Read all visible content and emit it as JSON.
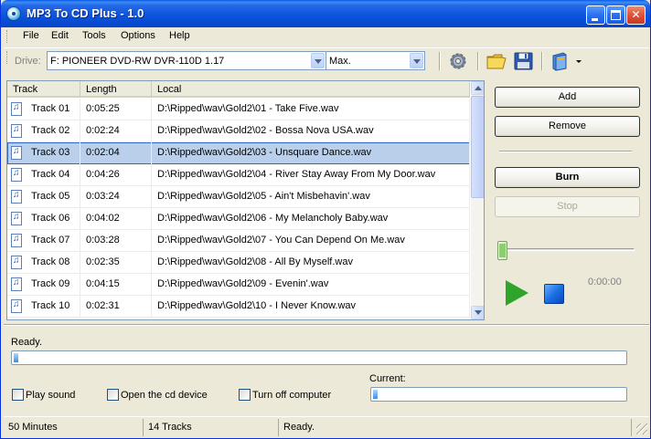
{
  "window": {
    "title": "MP3 To CD Plus - 1.0"
  },
  "menu": [
    "File",
    "Edit",
    "Tools",
    "Options",
    "Help"
  ],
  "toolbar": {
    "drive_label": "Drive:",
    "drive_value": "F: PIONEER  DVD-RW  DVR-110D 1.17",
    "speed_value": "Max.",
    "icons": [
      "gear-icon",
      "folder-open-icon",
      "save-disk-icon",
      "cd-case-icon"
    ]
  },
  "list": {
    "columns": [
      "Track",
      "Length",
      "Local"
    ],
    "rows": [
      {
        "track": "Track 01",
        "length": "0:05:25",
        "local": "D:\\Ripped\\wav\\Gold2\\01 - Take Five.wav"
      },
      {
        "track": "Track 02",
        "length": "0:02:24",
        "local": "D:\\Ripped\\wav\\Gold2\\02 - Bossa Nova USA.wav"
      },
      {
        "track": "Track 03",
        "length": "0:02:04",
        "local": "D:\\Ripped\\wav\\Gold2\\03 - Unsquare Dance.wav",
        "selected": true
      },
      {
        "track": "Track 04",
        "length": "0:04:26",
        "local": "D:\\Ripped\\wav\\Gold2\\04 - River Stay Away From My Door.wav"
      },
      {
        "track": "Track 05",
        "length": "0:03:24",
        "local": "D:\\Ripped\\wav\\Gold2\\05 - Ain't Misbehavin'.wav"
      },
      {
        "track": "Track 06",
        "length": "0:04:02",
        "local": "D:\\Ripped\\wav\\Gold2\\06 - My Melancholy Baby.wav"
      },
      {
        "track": "Track 07",
        "length": "0:03:28",
        "local": "D:\\Ripped\\wav\\Gold2\\07 - You Can Depend On Me.wav"
      },
      {
        "track": "Track 08",
        "length": "0:02:35",
        "local": "D:\\Ripped\\wav\\Gold2\\08 - All By Myself.wav"
      },
      {
        "track": "Track 09",
        "length": "0:04:15",
        "local": "D:\\Ripped\\wav\\Gold2\\09 - Evenin'.wav"
      },
      {
        "track": "Track 10",
        "length": "0:02:31",
        "local": "D:\\Ripped\\wav\\Gold2\\10 - I Never Know.wav"
      }
    ]
  },
  "buttons": {
    "add": "Add",
    "remove": "Remove",
    "burn": "Burn",
    "stop": "Stop"
  },
  "player": {
    "time": "0:00:00",
    "position": 0
  },
  "status": {
    "message": "Ready.",
    "overall_progress": 0,
    "current_label": "Current:",
    "current_progress": 0
  },
  "options": {
    "play_sound": "Play sound",
    "open_cd": "Open the cd device",
    "turn_off": "Turn off computer"
  },
  "statusbar": {
    "minutes": "50 Minutes",
    "tracks": "14 Tracks",
    "state": "Ready."
  },
  "colors": {
    "titlebar": "#0a52dc",
    "selection": "#b9cfea",
    "face": "#ece9d8"
  }
}
